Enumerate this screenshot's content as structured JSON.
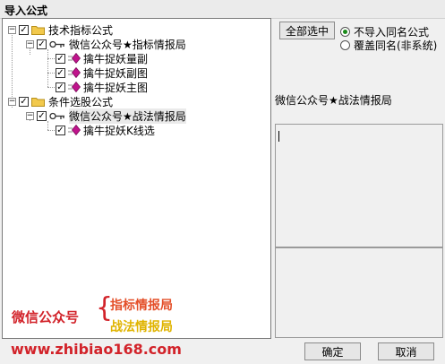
{
  "window": {
    "title": "导入公式"
  },
  "tree": {
    "root1": {
      "label": "技术指标公式",
      "expander": "−",
      "checked": "✓"
    },
    "child1": {
      "label": "微信公众号★指标情报局",
      "expander": "−",
      "checked": "✓"
    },
    "leaves1": [
      {
        "label": "擒牛捉妖量副",
        "checked": "✓"
      },
      {
        "label": "擒牛捉妖副图",
        "checked": "✓"
      },
      {
        "label": "擒牛捉妖主图",
        "checked": "✓"
      }
    ],
    "root2": {
      "label": "条件选股公式",
      "expander": "−",
      "checked": "✓"
    },
    "child2": {
      "label": "微信公众号★战法情报局",
      "expander": "−",
      "checked": "✓"
    },
    "leaves2": [
      {
        "label": "擒牛捉妖K线选",
        "checked": "✓"
      }
    ]
  },
  "controls": {
    "select_all_label": "全部选中",
    "radio_skip_label": "不导入同名公式",
    "radio_overwrite_label": "覆盖同名(非系统)",
    "selected_radio": "skip"
  },
  "info": {
    "selected_name": "微信公众号★战法情报局"
  },
  "watermark": {
    "line1": "微信公众号",
    "brace": "{",
    "line2": "指标情报局",
    "line3": "战法情报局",
    "url": "www.zhibiao168.com"
  },
  "footer": {
    "ok_label": "确定",
    "cancel_label": "取消"
  },
  "colors": {
    "folder": "#f2c94c",
    "file_icon": "#c0148c",
    "radio_dot": "#1a8a1a",
    "watermark_red": "#d2232a",
    "watermark_orange": "#e4502a",
    "watermark_yellow": "#e0b400"
  }
}
